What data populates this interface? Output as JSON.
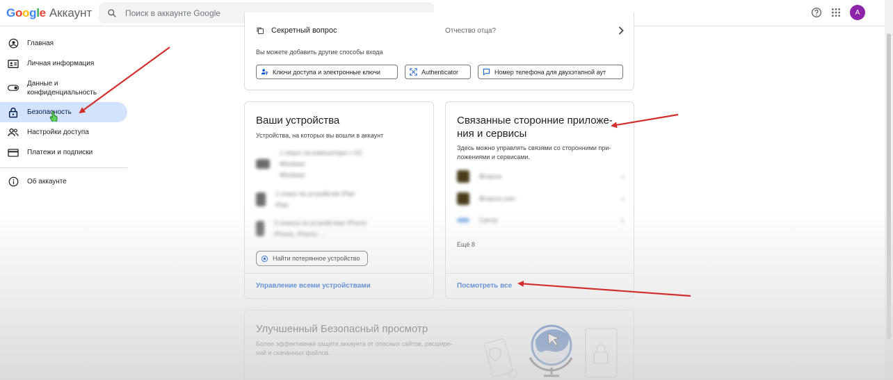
{
  "header": {
    "logo_google": "Google",
    "logo_account": "Аккаунт",
    "search_placeholder": "Поиск в аккаунте Google",
    "avatar_letter": "A"
  },
  "colors": {
    "accent": "#0b57d0",
    "active_bg": "#d3e3fd",
    "avatar": "#8e24aa",
    "arrow": "#d32f2f"
  },
  "sidebar": {
    "items": [
      {
        "label": "Главная",
        "icon": "account-circle-icon"
      },
      {
        "label": "Личная информация",
        "icon": "id-card-icon"
      },
      {
        "label": "Данные и конфиденциальность",
        "icon": "toggle-icon"
      },
      {
        "label": "Безопасность",
        "icon": "lock-icon"
      },
      {
        "label": "Настройки доступа",
        "icon": "people-icon"
      },
      {
        "label": "Платежи и подписки",
        "icon": "credit-card-icon"
      },
      {
        "label": "Об аккаунте",
        "icon": "info-icon"
      }
    ]
  },
  "signin": {
    "secret_question": "Секретный вопрос",
    "secret_answer": "Отчество отца?",
    "hint": "Вы можете добавить другие способы входа",
    "chips": [
      "Ключи доступа и электронные ключи",
      "Authenticator",
      "Номер телефона для двухэтапной аут"
    ]
  },
  "devices": {
    "title": "Ваши устройства",
    "desc": "Устройства, на которых вы вошли в аккаунт",
    "rows": [
      {
        "line1": "1 сеанс на компьютере с ОС",
        "line2": "Windows",
        "line3": "Windows"
      },
      {
        "line1": "1 сеанс на устройстве iPad",
        "line2": "iPad"
      },
      {
        "line1": "3 сеанса на устройствах iPhone",
        "line2": "iPhone, iPhone, ..."
      }
    ],
    "find_button": "Найти потерянное устройство",
    "manage_link": "Управление всеми устройствами"
  },
  "apps": {
    "title_line1": "Связанные сторонние приложе-",
    "title_line2": "ния и сервисы",
    "desc_line1": "Здесь можно управлять связями со сторонними при-",
    "desc_line2": "ложениями и сервисами.",
    "rows": [
      "Binance",
      "Binance.com",
      "Canva"
    ],
    "more": "Ещё 8",
    "view_all": "Посмотреть все"
  },
  "browsing": {
    "title": "Улучшенный Безопасный просмотр",
    "desc_line1": "Более эффективная защита аккаунта от опасных сайтов, расшире-",
    "desc_line2": "ний и скачанных файлов."
  }
}
